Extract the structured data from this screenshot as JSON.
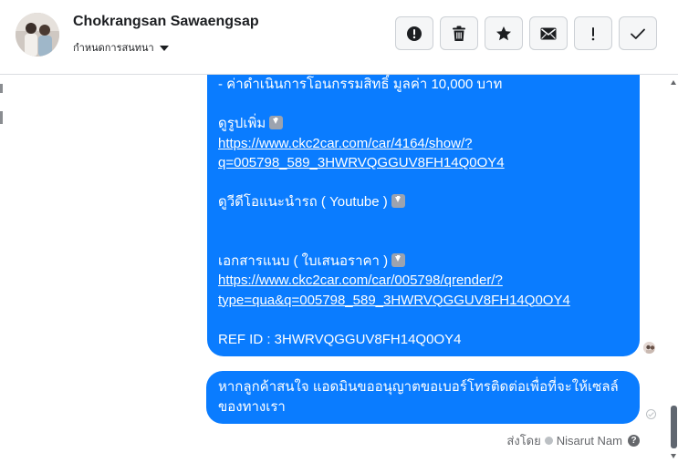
{
  "header": {
    "contact_name": "Chokrangsan Sawaengsap",
    "assign_label": "กำหนดการสนทนา"
  },
  "toolbar": {
    "buttons": [
      {
        "icon": "alert-circle-icon",
        "name": "mark-spam-button"
      },
      {
        "icon": "trash-icon",
        "name": "delete-button"
      },
      {
        "icon": "star-icon",
        "name": "star-button"
      },
      {
        "icon": "envelope-icon",
        "name": "mark-unread-button"
      },
      {
        "icon": "exclamation-icon",
        "name": "follow-up-button"
      },
      {
        "icon": "check-icon",
        "name": "mark-done-button"
      }
    ]
  },
  "messages": {
    "long": {
      "line_fee": "- ค่าดำเนินการโอนกรรมสิทธิ์     มูลค่า 10,000 บาท",
      "more_pics_label": "ดูรูปเพิ่ม",
      "link1_line1": "https://www.ckc2car.com/car/4164/show/?",
      "link1_line2": "q=005798_589_3HWRVQGGUV8FH14Q0OY4",
      "video_label": "ดูวีดีโอแนะนำรถ ( Youtube )",
      "attachment_label": "เอกสารแนบ ( ใบเสนอราคา )",
      "link2_line1": "https://www.ckc2car.com/car/005798/qrender/?",
      "link2_line2": "type=qua&q=005798_589_3HWRVQGGUV8FH14Q0OY4",
      "ref_id": "REF ID : 3HWRVQGGUV8FH14Q0OY4"
    },
    "short": {
      "line1": "หากลูกค้าสนใจ แอดมินขออนุญาตขอเบอร์โทรติดต่อเพื่อที่จะให้เซลล์",
      "line2": "ของทางเรา"
    }
  },
  "footer": {
    "sent_by_label": "ส่งโดย",
    "sender_name": "Nisarut Nam",
    "help_glyph": "?"
  },
  "colors": {
    "bubble": "#0a7cff",
    "header_border": "#dadde1",
    "button_bg": "#f5f6f7"
  }
}
